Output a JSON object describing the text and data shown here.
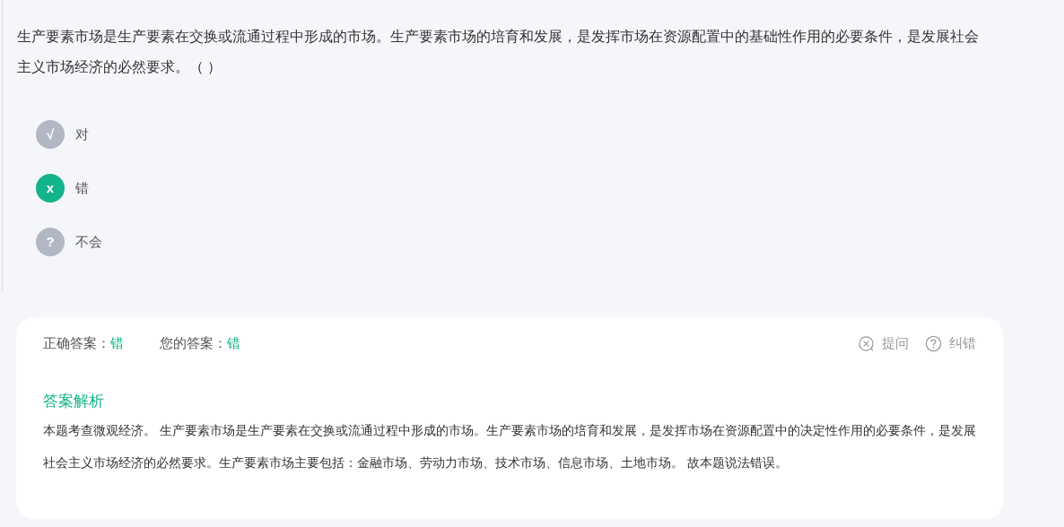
{
  "question": "生产要素市场是生产要素在交换或流通过程中形成的市场。生产要素市场的培育和发展，是发挥市场在资源配置中的基础性作用的必要条件，是发展社会主义市场经济的必然要求。（   ）",
  "options": [
    {
      "symbol": "√",
      "label": "对",
      "selected": false
    },
    {
      "symbol": "x",
      "label": "错",
      "selected": true
    },
    {
      "symbol": "?",
      "label": "不会",
      "selected": false
    }
  ],
  "result": {
    "correct_label": "正确答案：",
    "correct_value": "错",
    "yours_label": "您的答案：",
    "yours_value": "错",
    "actions": [
      {
        "kind": "ask",
        "label": "提问"
      },
      {
        "kind": "report",
        "label": "纠错"
      }
    ]
  },
  "analysis": {
    "title": "答案解析",
    "text": "本题考查微观经济。 生产要素市场是生产要素在交换或流通过程中形成的市场。生产要素市场的培育和发展，是发挥市场在资源配置中的决定性作用的必要条件，是发展社会主义市场经济的必然要求。生产要素市场主要包括：金融市场、劳动力市场、技术市场、信息市场、土地市场。 故本题说法错误。"
  }
}
